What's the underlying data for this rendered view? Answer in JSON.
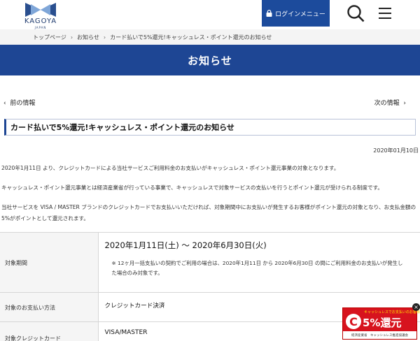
{
  "header": {
    "brand": "KAGOYA",
    "brand_sub": "JAPAN",
    "login_label": "ログインメニュー"
  },
  "breadcrumb": {
    "items": [
      "トップページ",
      "お知らせ",
      "カード払いで5%還元!キャッシュレス・ポイント還元のお知らせ"
    ]
  },
  "page_title": "お知らせ",
  "nav": {
    "prev": "前の情報",
    "next": "次の情報"
  },
  "article": {
    "title": "カード払いで5%還元!キャッシュレス・ポイント還元のお知らせ",
    "date": "2020年01月10日",
    "paragraphs": [
      "2020年1月11日 より、クレジットカードによる当社サービスご利用料金のお支払いがキャッシュレス・ポイント還元事業の対象となります。",
      "キャッシュレス・ポイント還元事業とは経済産業省が行っている事業で、キャッシュレスで対象サービスの支払いを行うとポイント還元が受けられる制度です。",
      "当社サービスを VISA / MASTER ブランドのクレジットカードでお支払いいただければ、対象期間中にお支払いが発生するお客様がポイント還元の対象となり、お支払金額の5%がポイントとして還元されます。"
    ]
  },
  "info_table": {
    "period_label": "対象期間",
    "period_value": "2020年1月11日(土) ～ 2020年6月30日(火)",
    "period_note": "※ 12ヶ月一括支払いの契約でご利用の場合は、2020年1月11日 から 2020年6月30日 の間にご利用料金のお支払いが発生した場合のみ対象です。",
    "method_label": "対象のお支払い方法",
    "method_value": "クレジットカード決済",
    "card_label": "対象クレジットカード",
    "card_value": "VISA/MASTER"
  },
  "cashless_banner": {
    "top": "キャッシュレスでお支払いのお客様",
    "main": "5%還元",
    "bottom": "経済産業省　キャッシュレス推進協議会",
    "icon_letter": "C"
  },
  "colors": {
    "brand_blue": "#1e4694",
    "login_blue": "#1c4b9c",
    "cashless_red": "#d7131e"
  }
}
